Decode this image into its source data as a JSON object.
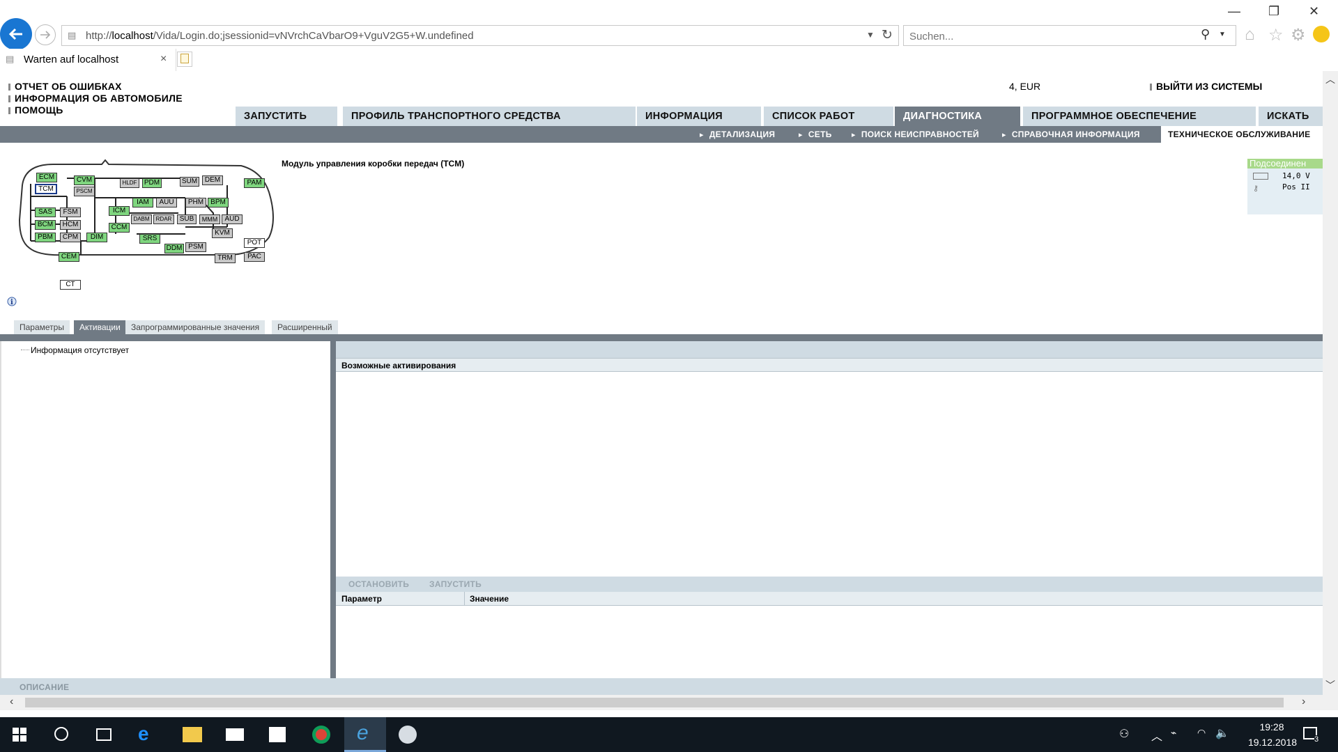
{
  "browser": {
    "url_prefix": "http://",
    "url_host": "localhost",
    "url_path": "/Vida/Login.do;jsessionid=vNVrchCaVbarO9+VguV2G5+W.undefined",
    "search_placeholder": "Suchen...",
    "tab_title": "Warten auf localhost",
    "tab_close": "×"
  },
  "header": {
    "links": [
      "ОТЧЕТ ОБ ОШИБКАХ",
      "ИНФОРМАЦИЯ ОБ АВТОМОБИЛЕ",
      "ПОМОЩЬ"
    ],
    "currency": "4, EUR",
    "logout": "ВЫЙТИ ИЗ СИСТЕМЫ"
  },
  "main_tabs": [
    "ЗАПУСТИТЬ",
    "ПРОФИЛЬ ТРАНСПОРТНОГО СРЕДСТВА",
    "ИНФОРМАЦИЯ",
    "СПИСОК РАБОТ",
    "ДИАГНОСТИКА",
    "ПРОГРАММНОЕ ОБЕСПЕЧЕНИЕ",
    "ИСКАТЬ"
  ],
  "active_main_tab": "ДИАГНОСТИКА",
  "sub_tabs": [
    "ДЕТАЛИЗАЦИЯ",
    "СЕТЬ",
    "ПОИСК НЕИСПРАВНОСТЕЙ",
    "СПРАВОЧНАЯ ИНФОРМАЦИЯ"
  ],
  "active_sub_tab": "ТЕХНИЧЕСКОЕ ОБСЛУЖИВАНИЕ",
  "module_title": "Модуль управления коробки передач (TCM)",
  "status": {
    "connection": "Подсоединен",
    "voltage": "14,0 V",
    "ignition": "Pos II"
  },
  "modules": {
    "ecm": "ECM",
    "tcm": "TCM",
    "cvm": "CVM",
    "pscm": "PSCM",
    "hldf": "HLDF",
    "pdm": "PDM",
    "sum": "SUM",
    "dem": "DEM",
    "pam": "PAM",
    "sas": "SAS",
    "fsm": "FSM",
    "icm": "ICM",
    "iam": "IAM",
    "auu": "AUU",
    "phm": "PHM",
    "bpm": "BPM",
    "bcm": "BCM",
    "hcm": "HCM",
    "dabm": "DABM",
    "rdar": "RDAR",
    "sub": "SUB",
    "mmm": "MMM",
    "aud": "AUD",
    "ccm": "CCM",
    "pbm": "PBM",
    "cpm": "CPM",
    "dim": "DIM",
    "srs": "SRS",
    "kvm": "KVM",
    "ddm": "DDM",
    "psm": "PSM",
    "pot": "POT",
    "cem": "CEM",
    "trm": "TRM",
    "pac": "PAC",
    "ct": "CT"
  },
  "lower_tabs": [
    "Параметры",
    "Активации",
    "Запрограммированные значения",
    "Расширенный"
  ],
  "active_lower_tab": "Активации",
  "tree_item": "Информация отсутствует",
  "activations_title": "Возможные активирования",
  "buttons": {
    "stop": "ОСТАНОВИТЬ",
    "start": "ЗАПУСТИТЬ"
  },
  "grid_headers": {
    "param": "Параметр",
    "value": "Значение"
  },
  "description_label": "ОПИСАНИЕ",
  "taskbar": {
    "time": "19:28",
    "date": "19.12.2018",
    "notifications": "3"
  },
  "colors": {
    "tab_bg": "#cfdbe3",
    "tab_active": "#707a84",
    "module_green": "#7fd67f",
    "module_grey": "#c8c8c8",
    "ie_blue": "#1976d2"
  }
}
